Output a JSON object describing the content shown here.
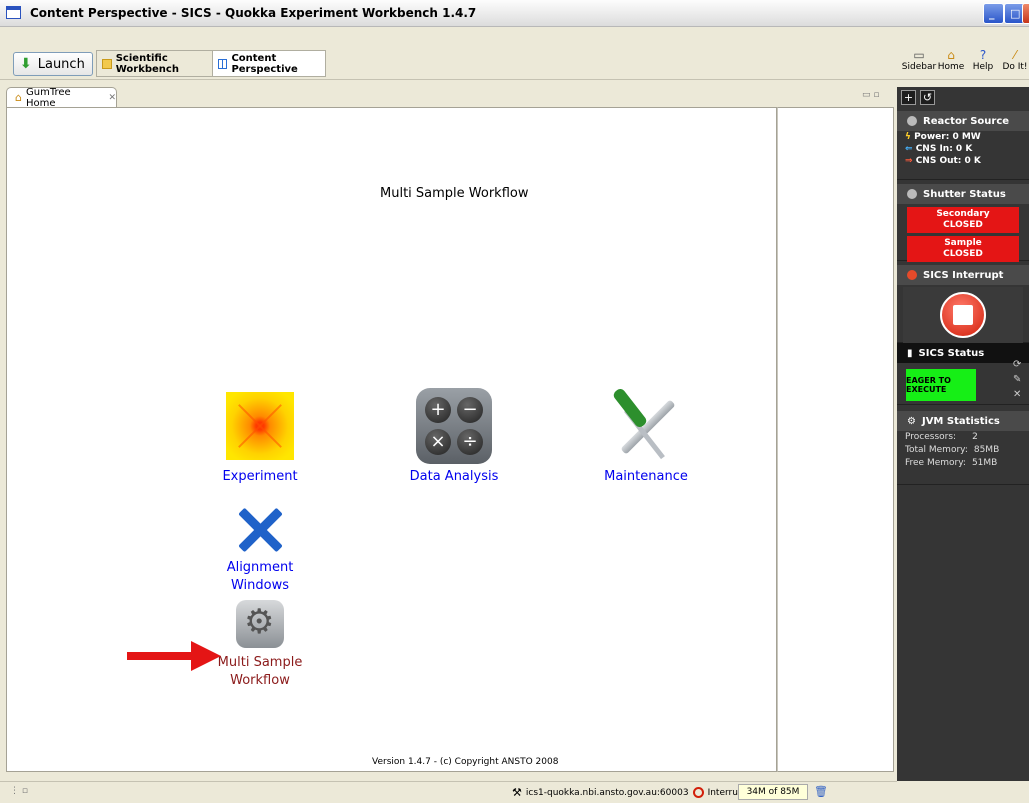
{
  "window": {
    "title": "Content Perspective - SICS - Quokka Experiment Workbench 1.4.7"
  },
  "toolbar": {
    "launch_label": "Launch",
    "perspectives": [
      {
        "label": "Scientific Workbench"
      },
      {
        "label": "Content Perspective"
      }
    ],
    "right_tools": [
      {
        "label": "Sidebar",
        "icon": "sidebar-icon"
      },
      {
        "label": "Home",
        "icon": "home-icon"
      },
      {
        "label": "Help",
        "icon": "help-icon"
      },
      {
        "label": "Do It!",
        "icon": "wand-icon"
      }
    ]
  },
  "editor": {
    "tab_label": "GumTree Home",
    "page_title": "Multi Sample Workflow",
    "tiles": [
      {
        "label": "Experiment",
        "icon": "experiment-icon"
      },
      {
        "label": "Data Analysis",
        "icon": "calculator-icon"
      },
      {
        "label": "Maintenance",
        "icon": "tools-icon"
      },
      {
        "label_line1": "Alignment",
        "label_line2": "Windows",
        "icon": "alignment-icon"
      },
      {
        "label_line1": "Multi Sample",
        "label_line2": "Workflow",
        "icon": "gear-icon"
      }
    ],
    "version": "Version 1.4.7 - (c) Copyright ANSTO 2008"
  },
  "sidebar": {
    "reactor": {
      "title": "Reactor Source",
      "power": "Power: 0 MW",
      "cns_in": "CNS In: 0 K",
      "cns_out": "CNS Out: 0 K"
    },
    "shutter": {
      "title": "Shutter Status",
      "secondary_1": "Secondary",
      "secondary_2": "CLOSED",
      "sample_1": "Sample",
      "sample_2": "CLOSED",
      "color_closed": "#e41515"
    },
    "interrupt": {
      "title": "SICS Interrupt"
    },
    "status": {
      "title": "SICS Status",
      "value": "EAGER TO EXECUTE",
      "color": "#16ef16"
    },
    "jvm": {
      "title": "JVM Statistics",
      "processors_label": "Processors:",
      "processors_value": "2",
      "total_label": "Total Memory:",
      "total_value": "85MB",
      "free_label": "Free Memory:",
      "free_value": "51MB"
    }
  },
  "statusbar": {
    "connection": "ics1-quokka.nbi.ansto.gov.au:60003",
    "interrupt_label": "Interrupt",
    "memory": "34M of 85M"
  }
}
